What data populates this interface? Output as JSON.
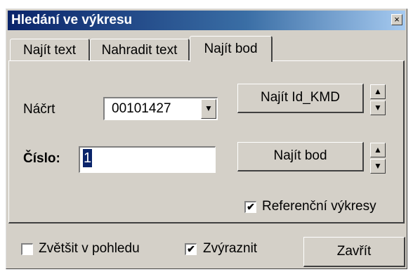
{
  "window": {
    "title": "Hledání ve výkresu",
    "close_glyph": "×"
  },
  "tabs": [
    {
      "label": "Najít text",
      "active": false
    },
    {
      "label": "Nahradit text",
      "active": false
    },
    {
      "label": "Najít bod",
      "active": true
    }
  ],
  "form": {
    "nacrt_label": "Náčrt",
    "nacrt_value": "00101427",
    "cislo_label": "Číslo:",
    "cislo_value": "1",
    "find_kmd_button": "Najít Id_KMD",
    "find_point_button": "Najít bod",
    "spin_up_glyph": "▲",
    "spin_down_glyph": "▼",
    "combo_arrow_glyph": "▼",
    "reference_checkbox": {
      "label": "Referenční výkresy",
      "checked": true,
      "glyph": "✔"
    }
  },
  "footer": {
    "zoom_checkbox": {
      "label": "Zvětšit v pohledu",
      "checked": false
    },
    "highlight_checkbox": {
      "label": "Zvýraznit",
      "checked": true,
      "glyph": "✔"
    },
    "close_button": "Zavřít"
  }
}
